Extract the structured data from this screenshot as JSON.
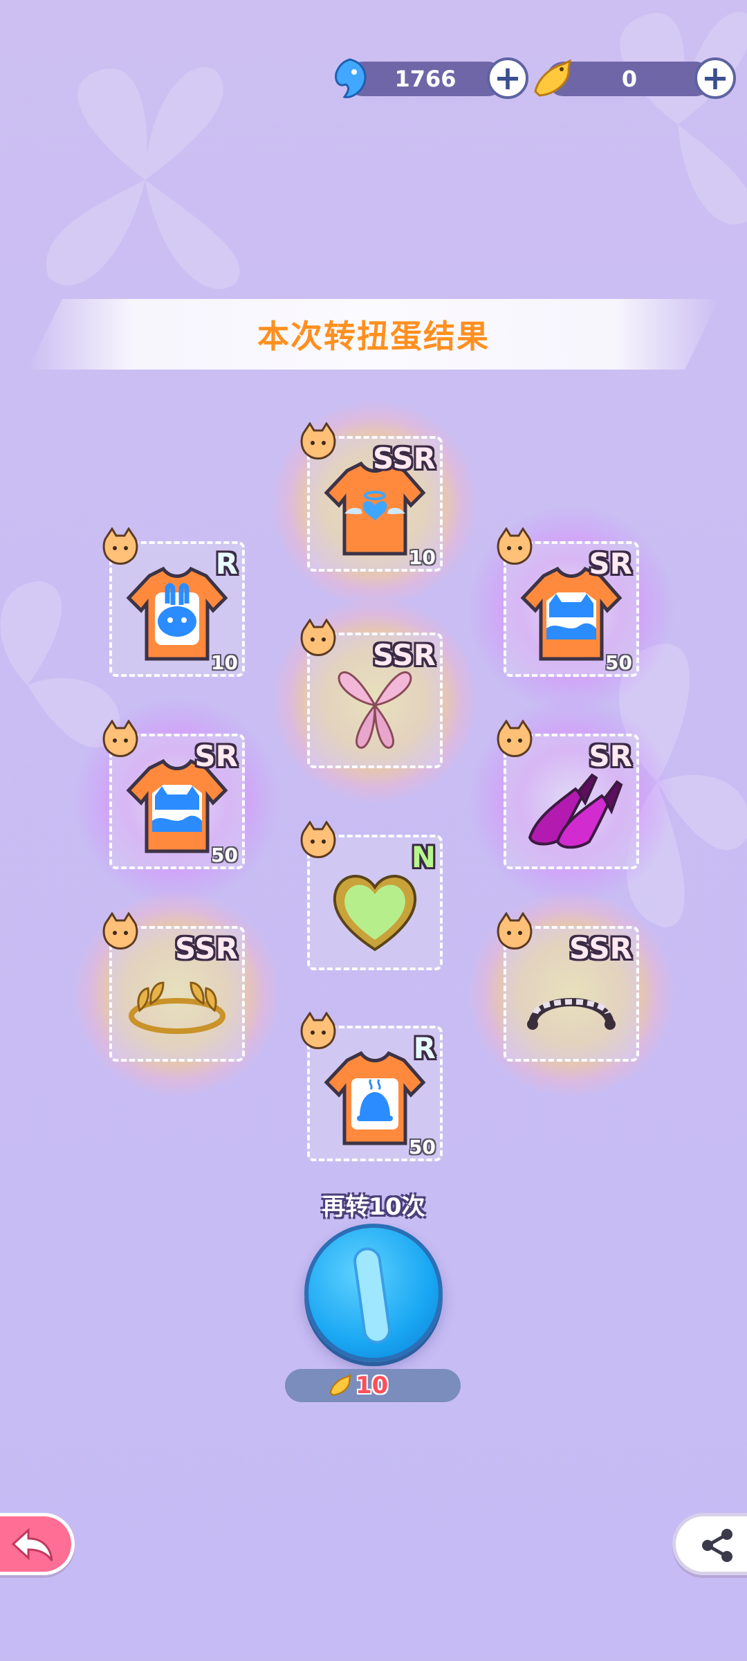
{
  "topbar": {
    "gems": {
      "icon": "blue-gem-fish-icon",
      "value": "1766",
      "add_icon": "plus-icon"
    },
    "fish": {
      "icon": "golden-fish-icon",
      "value": "0",
      "add_icon": "plus-icon"
    }
  },
  "banner": {
    "title": "本次转扭蛋结果"
  },
  "results": [
    {
      "item": "angel-heart-tshirt",
      "rarity": "SSR",
      "qty": "10"
    },
    {
      "item": "bunny-tshirt",
      "rarity": "R",
      "qty": "10"
    },
    {
      "item": "cat-wave-tshirt",
      "rarity": "SR",
      "qty": "50"
    },
    {
      "item": "fairy-wings",
      "rarity": "SSR",
      "qty": ""
    },
    {
      "item": "cat-wave-tshirt",
      "rarity": "SR",
      "qty": "50"
    },
    {
      "item": "purple-heels",
      "rarity": "SR",
      "qty": ""
    },
    {
      "item": "green-heart-badge",
      "rarity": "N",
      "qty": ""
    },
    {
      "item": "golden-laurel-crown",
      "rarity": "SSR",
      "qty": ""
    },
    {
      "item": "black-maid-headband",
      "rarity": "SSR",
      "qty": ""
    },
    {
      "item": "bell-tshirt",
      "rarity": "R",
      "qty": "50"
    }
  ],
  "spin_again": {
    "label": "再转10次",
    "cost_icon": "golden-fish-icon",
    "cost": "10"
  },
  "nav": {
    "back_icon": "back-arrow-icon",
    "share_icon": "share-icon"
  },
  "colors": {
    "title": "#ff8f1f",
    "background": "#cdbff2",
    "cost": "#ff4f5a",
    "back_button": "#ff6f95"
  }
}
